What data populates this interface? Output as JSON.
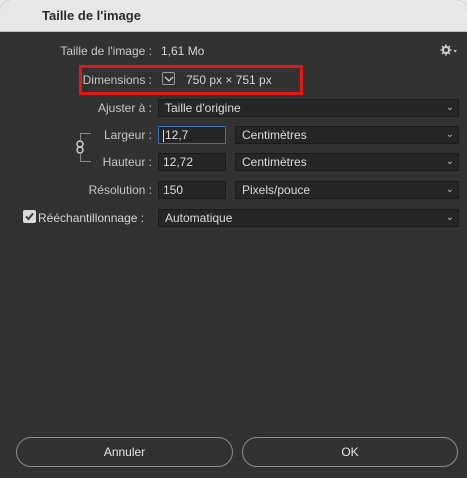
{
  "window": {
    "title": "Taille de l'image"
  },
  "image_size": {
    "label": "Taille de l'image :",
    "value": "1,61 Mo"
  },
  "dimensions": {
    "label": "Dimensions :",
    "value": "750 px  ×  751 px"
  },
  "fit_to": {
    "label": "Ajuster à :",
    "value": "Taille d'origine"
  },
  "width": {
    "label": "Largeur :",
    "value": "12,7",
    "unit": "Centimètres"
  },
  "height": {
    "label": "Hauteur :",
    "value": "12,72",
    "unit": "Centimètres"
  },
  "resolution": {
    "label": "Résolution :",
    "value": "150",
    "unit": "Pixels/pouce"
  },
  "resample": {
    "label": "Rééchantillonnage :",
    "value": "Automatique",
    "checked": true
  },
  "buttons": {
    "cancel": "Annuler",
    "ok": "OK"
  },
  "icons": {
    "gear": "gear-icon",
    "chain": "chain-link-icon",
    "chevron": "chevron-down-icon",
    "check": "checkmark-icon"
  },
  "colors": {
    "highlight": "#e01818",
    "focus": "#3e6fb6",
    "background": "#323232"
  }
}
